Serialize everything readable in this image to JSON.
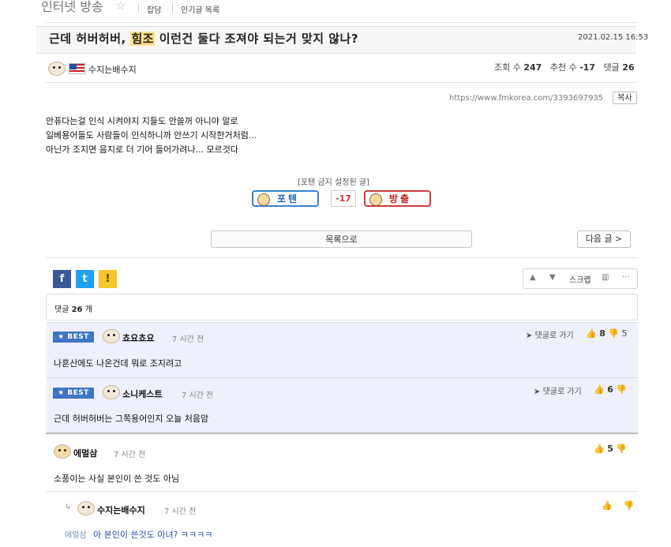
{
  "top": {
    "board_title": "인터넷 방송",
    "nav": [
      "잡담",
      "인기글 목록"
    ]
  },
  "post": {
    "title_before": "근데 허버허버, ",
    "title_highlight": "힘조",
    "title_after": " 이런건 둘다 조져야 되는거 맞지 않나?",
    "date": "2021.02.15 16:53",
    "author": "수지는배수지",
    "views_label": "조회 수",
    "views": "247",
    "recommend_label": "추천 수",
    "recommend": "-17",
    "comments_label": "댓글",
    "comments": "26",
    "url": "https://www.fmkorea.com/3393697935",
    "copy_label": "복사",
    "body": [
      "안퓨다는걸 인식 시켜야지 지들도 안쓸꺼 아니야 말로",
      "일베용어들도 사람들이 인식하니까 안쓰기 시작한거처럼...",
      "아닌가 조지면 음지로 더 기어 들어가려나... 모르것다"
    ]
  },
  "vote": {
    "caption": "[포텐 금지 설정된 글]",
    "up_label": "포텐",
    "score": "-17",
    "down_label": "방출"
  },
  "buttons": {
    "list": "목록으로",
    "next": "다음 글 >"
  },
  "share": {
    "facebook": "f",
    "twitter": "t",
    "kakao": "!"
  },
  "tools": {
    "up": "▲",
    "down": "▼",
    "scrap": "스크랩",
    "more": "···"
  },
  "comments_header": {
    "label": "댓글",
    "count": "26",
    "suffix": "개"
  },
  "comments": [
    {
      "best": "★ BEST",
      "author": "쵸요쵸요",
      "time": "7 시간 전",
      "reply": "댓글로 가기",
      "likes": "8",
      "dislikes": "5",
      "body": "나혼산에도 나온건데 뭐로 조지려고"
    },
    {
      "best": "★ BEST",
      "author": "소니케스트",
      "time": "7 시간 전",
      "reply": "댓글로 가기",
      "likes": "6",
      "dislikes": "",
      "body": "근데 허버허버는 그쪽용어인지 오늘 처음암"
    },
    {
      "author": "에멀삼",
      "time": "7 시간 전",
      "likes": "5",
      "dislikes": "",
      "body": "소풍이는 사실 본인이 쓴 것도 아님"
    },
    {
      "reply_arrow": "↳",
      "author": "수지는배수지",
      "time": "7 시간 전",
      "likes": "",
      "dislikes": "",
      "reply_to": "에멀삼",
      "body": "아 본인이 쓴것도 아녀? ㅋㅋㅋㅋ"
    }
  ],
  "colors": {
    "best_badge": "#3f74c6",
    "best_bg": "#eef0fb",
    "title_highlight": "#ffe08a",
    "vote_up": "#2463b0",
    "vote_down": "#c02222"
  }
}
